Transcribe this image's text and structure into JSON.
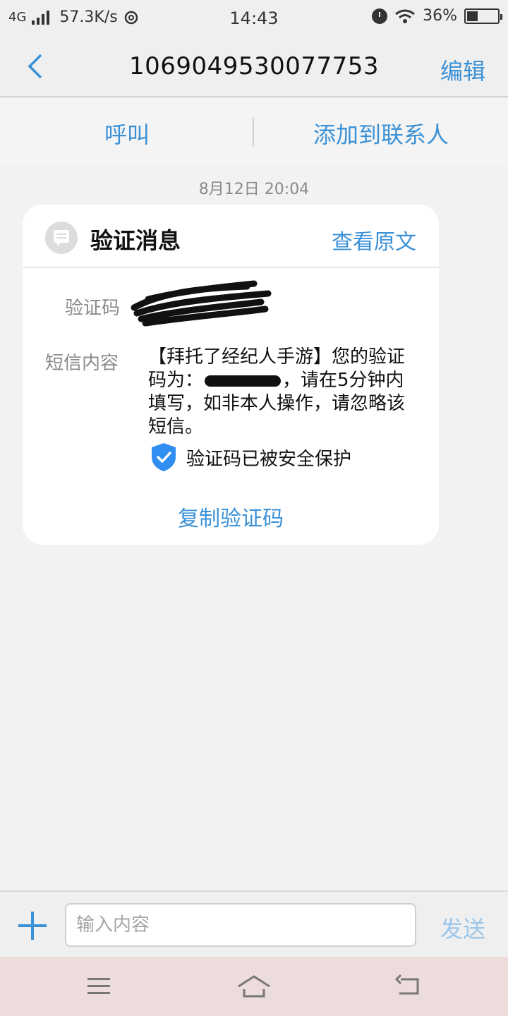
{
  "status_bar": {
    "network": "4G",
    "speed": "57.3K/s",
    "time": "14:43",
    "battery": "36%",
    "battery_level": 0.36
  },
  "header": {
    "title": "1069049530077753",
    "edit_label": "编辑"
  },
  "actions": {
    "call_label": "呼叫",
    "add_contact_label": "添加到联系人"
  },
  "timestamp": "8月12日 20:04",
  "card": {
    "title": "验证消息",
    "view_original_label": "查看原文",
    "code_label": "验证码",
    "content_label": "短信内容",
    "sms_part1": "【拜托了经纪人手游】您的验证码为：",
    "sms_part2": "，请在5分钟内填写，如非本人操作，请忽略该短信。",
    "secure_label": "验证码已被安全保护",
    "copy_label": "复制验证码"
  },
  "input_bar": {
    "placeholder": "输入内容",
    "send_label": "发送"
  },
  "colors": {
    "accent": "#3b91d6",
    "send_disabled": "#9cc6ea",
    "shield": "#2f8ef0"
  }
}
